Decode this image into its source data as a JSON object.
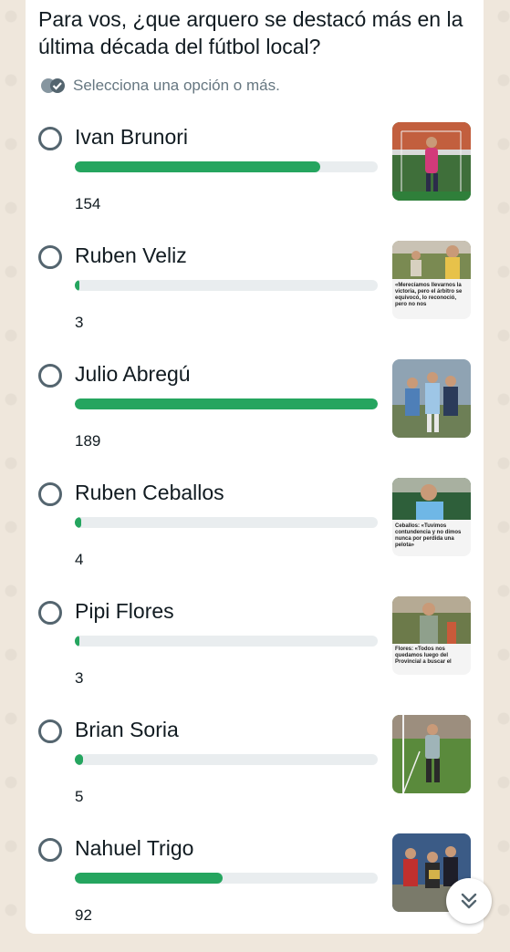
{
  "poll": {
    "question": "Para vos, ¿que arquero se destacó más en la última década del fútbol local?",
    "hint": "Selecciona una opción o más.",
    "hint_icon": "double-check-icon",
    "accent_color": "#25a55f",
    "options": [
      {
        "label": "Ivan Brunori",
        "votes": "154",
        "share": 0.81,
        "thumb_icon": "photo-goalkeeper-icon"
      },
      {
        "label": "Ruben Veliz",
        "votes": "3",
        "share": 0.016,
        "thumb_icon": "photo-news-icon",
        "thumb_caption": "«Merecíamos llevarnos la victoria, pero el árbitro se equivocó, lo reconoció, pero no nos"
      },
      {
        "label": "Julio Abregú",
        "votes": "189",
        "share": 1.0,
        "thumb_icon": "photo-group-icon"
      },
      {
        "label": "Ruben Ceballos",
        "votes": "4",
        "share": 0.021,
        "thumb_icon": "photo-news-icon",
        "thumb_caption": "Ceballos: «Tuvimos contundencia y no dimos nunca por perdida una pelota»"
      },
      {
        "label": "Pipi Flores",
        "votes": "3",
        "share": 0.016,
        "thumb_icon": "photo-news-icon",
        "thumb_caption": "Flores: «Todos nos quedamos luego del Provincial a buscar el"
      },
      {
        "label": "Brian Soria",
        "votes": "5",
        "share": 0.026,
        "thumb_icon": "photo-goalkeeper-icon"
      },
      {
        "label": "Nahuel Trigo",
        "votes": "92",
        "share": 0.487,
        "thumb_icon": "photo-group-icon"
      }
    ]
  },
  "scroll_button": {
    "icon": "double-chevron-down-icon"
  }
}
